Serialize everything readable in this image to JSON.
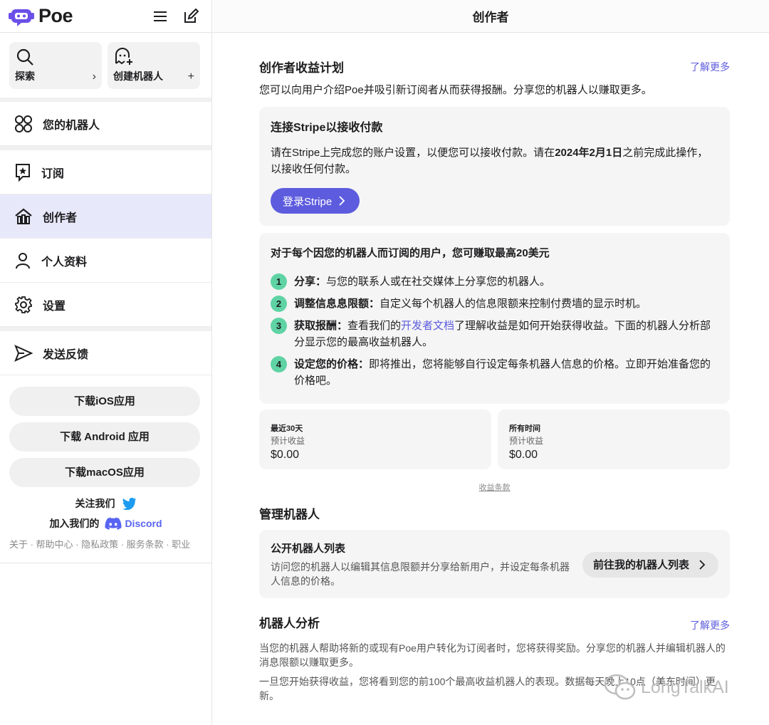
{
  "app": {
    "name": "Poe"
  },
  "header": {
    "title": "创作者"
  },
  "sidebar": {
    "explore": {
      "label": "探索",
      "arrow": "›"
    },
    "create_bot": {
      "label": "创建机器人",
      "plus": "+"
    },
    "nav": [
      {
        "label": "您的机器人",
        "icon": "bots-grid-icon"
      },
      {
        "label": "订阅",
        "icon": "subscription-star-icon"
      },
      {
        "label": "创作者",
        "icon": "creator-icon"
      },
      {
        "label": "个人资料",
        "icon": "profile-icon"
      },
      {
        "label": "设置",
        "icon": "gear-icon"
      },
      {
        "label": "发送反馈",
        "icon": "send-icon"
      }
    ],
    "downloads": [
      "下载iOS应用",
      "下载 Android 应用",
      "下载macOS应用"
    ],
    "follow_us": "关注我们",
    "join_us": "加入我们的",
    "discord": "Discord",
    "footer_links": "关于 · 帮助中心 · 隐私政策 · 服务条款 · 职业"
  },
  "main": {
    "revenue": {
      "title": "创作者收益计划",
      "learn_more": "了解更多",
      "desc": "您可以向用户介绍Poe并吸引新订阅者从而获得报酬。分享您的机器人以赚取更多。"
    },
    "stripe": {
      "title": "连接Stripe以接收付款",
      "text_before": "请在Stripe上完成您的账户设置，以便您可以接收付款。请在",
      "date": "2024年2月1日",
      "text_after": "之前完成此操作，以接收任何付款。",
      "button": "登录Stripe"
    },
    "earn": {
      "title": "对于每个因您的机器人而订阅的用户，您可赚取最高20美元",
      "steps": [
        {
          "num": "1",
          "bold": "分享：",
          "text": "与您的联系人或在社交媒体上分享您的机器人。"
        },
        {
          "num": "2",
          "bold": "调整信息息限额：",
          "text": "自定义每个机器人的信息限额来控制付费墙的显示时机。"
        },
        {
          "num": "3",
          "bold": "获取报酬：",
          "pre": "查看我们的",
          "link": "开发者文档",
          "text": "了理解收益是如何开始获得收益。下面的机器人分析部分显示您的最高收益机器人。"
        },
        {
          "num": "4",
          "bold": "设定您的价格：",
          "text": "即将推出，您将能够自行设定每条机器人信息的价格。立即开始准备您的价格吧。"
        }
      ]
    },
    "stats": [
      {
        "period": "最近30天",
        "label": "预计收益",
        "value": "$0.00"
      },
      {
        "period": "所有时间",
        "label": "预计收益",
        "value": "$0.00"
      }
    ],
    "terms": "收益条款",
    "manage": {
      "title": "管理机器人",
      "card_title": "公开机器人列表",
      "card_desc": "访问您的机器人以编辑其信息限额并分享给新用户，并设定每条机器人信息的价格。",
      "button": "前往我的机器人列表"
    },
    "analytics": {
      "title": "机器人分析",
      "learn_more": "了解更多",
      "p1": "当您的机器人帮助将新的或现有Poe用户转化为订阅者时，您将获得奖励。分享您的机器人并编辑机器人的消息限额以赚取更多。",
      "p2": "一旦您开始获得收益，您将看到您的前100个最高收益机器人的表现。数据每天晚上10点（美东时间）更新。"
    }
  },
  "watermark": "LongTalkAI",
  "colors": {
    "accent": "#5d5cde",
    "step": "#5fd3a4",
    "active_bg": "#e8e8fb"
  }
}
